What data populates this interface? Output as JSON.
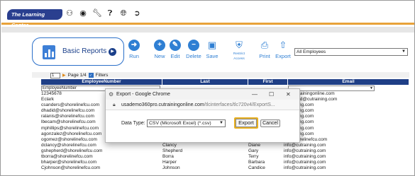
{
  "header": {
    "logo_text": "The Learning Center",
    "icons": [
      "users-icon",
      "user-circle-icon",
      "wrench-icon",
      "help-icon",
      "globe-icon",
      "logout-icon"
    ]
  },
  "report": {
    "title": "Basic Reports"
  },
  "toolbar": {
    "run": "Run",
    "new": "New",
    "edit": "Edit",
    "delete": "Delete",
    "save": "Save",
    "restrict_access_1": "Restrict",
    "restrict_access_2": "Access",
    "print": "Print",
    "export": "Export"
  },
  "employee_filter": {
    "selected": "All Employees"
  },
  "grid": {
    "page_select": "1",
    "page_label": "Page 1/4",
    "filters_label": "Filters",
    "columns": [
      "EmployeeNumber",
      "Last",
      "First",
      "Email"
    ],
    "filter_value": "EmployeeNumber",
    "rows": [
      {
        "emp": "12345678",
        "last": "",
        "first": "",
        "email": "...@cutrainingonline.com"
      },
      {
        "emp": "Eclark",
        "last": "",
        "first": "",
        "email": "...gerrard@cutraining.com"
      },
      {
        "emp": "csanders@shorelinefcu.com",
        "last": "",
        "first": "",
        "email": "cutraining.com"
      },
      {
        "emp": "dhadid@shorelinefcu.com",
        "last": "",
        "first": "",
        "email": "cutraining.com"
      },
      {
        "emp": "ralanis@shorelinefcu.com",
        "last": "",
        "first": "",
        "email": "cutraining.com"
      },
      {
        "emp": "lbecam@shorelinefcu.com",
        "last": "",
        "first": "",
        "email": "cutraining.com"
      },
      {
        "emp": "mphillips@shorelinefcu.com",
        "last": "",
        "first": "",
        "email": "cutraining.com"
      },
      {
        "emp": "agonzalez@shorelinefcu.com",
        "last": "",
        "first": "",
        "email": "cutraining.com"
      },
      {
        "emp": "ogomez@shorelinefcu.com",
        "last": "",
        "first": "",
        "email": "...@shorelinefcu.com"
      },
      {
        "emp": "dclancy@shorelinefcu.com",
        "last": "Clancy",
        "first": "Diane",
        "email": "info@cutraining.com"
      },
      {
        "emp": "gshepherd@shorelinefcu.com",
        "last": "Shepherd",
        "first": "Gary",
        "email": "info@cutraining.com"
      },
      {
        "emp": "tborra@shorelinefcu.com",
        "last": "Borra",
        "first": "Terry",
        "email": "info@cutraining.com"
      },
      {
        "emp": "bharper@shorelinefcu.com",
        "last": "Harper",
        "first": "Barbara",
        "email": "info@cutraining.com"
      },
      {
        "emp": "Cjohnson@shorelinefcu.com",
        "last": "Johnson",
        "first": "Candice",
        "email": "info@cutraining.com"
      }
    ]
  },
  "popup": {
    "title": "Export - Google Chrome",
    "url_host": "usademo360pro.cutrainingonline.com",
    "url_path": "/tlcinterfaces/tlc720v4/ExportS...",
    "data_type_label": "Data Type:",
    "data_type_value": "CSV (Microsoft Excel) (*.csv)",
    "export_button": "Export",
    "cancel_button": "Cancel",
    "highlight_color": "#e8b020"
  },
  "colors": {
    "accent_blue": "#2f7fd3",
    "header_navy": "#1f3f86",
    "orange_bar": "#e8a23a"
  }
}
